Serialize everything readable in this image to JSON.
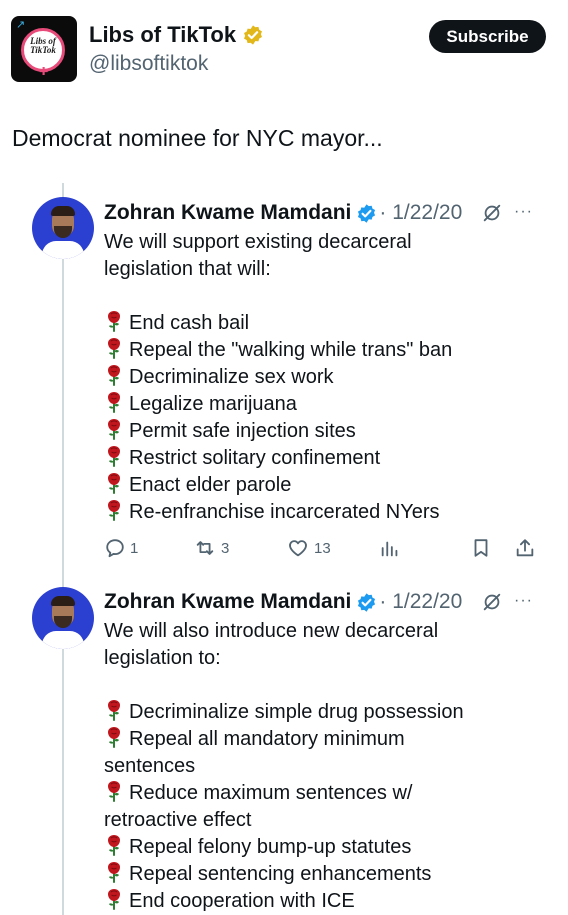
{
  "account": {
    "avatar_text_line1": "Libs of",
    "avatar_text_line2": "TikTok",
    "name": "Libs of TikTok",
    "handle": "@libsoftiktok",
    "verified_badge_icon": "gold-verified-badge-icon",
    "subscribe_label": "Subscribe"
  },
  "post": {
    "text": "Democrat nominee for NYC mayor..."
  },
  "colors": {
    "text": "#0f1419",
    "secondary": "#536471",
    "verified_blue": "#1d9bf0",
    "verified_gold": "#e2b719",
    "rose": "#c0161d",
    "subscribe_bg": "#0f1419"
  },
  "quoted_posts": [
    {
      "author": "Zohran Kwame Mamdani",
      "verified_icon": "blue-verified-badge-icon",
      "date": "· 1/22/20",
      "grok_icon": "grok-icon",
      "more_icon": "more-icon",
      "more_label": "···",
      "intro": [
        "We will support existing decarceral",
        "legislation that will:"
      ],
      "bullet_icon": "rose-emoji-icon",
      "items": [
        "End cash bail",
        "Repeal the \"walking while trans\" ban",
        "Decriminalize sex work",
        "Legalize marijuana",
        "Permit safe injection sites",
        "Restrict solitary confinement",
        "Enact elder parole",
        "Re-enfranchise incarcerated NYers"
      ],
      "actions": {
        "replies": "1",
        "reposts": "3",
        "likes": "13"
      }
    },
    {
      "author": "Zohran Kwame Mamdani",
      "verified_icon": "blue-verified-badge-icon",
      "date": "· 1/22/20",
      "grok_icon": "grok-icon",
      "more_icon": "more-icon",
      "more_label": "···",
      "intro": [
        "We will also introduce new decarceral",
        "legislation to:"
      ],
      "bullet_icon": "rose-emoji-icon",
      "items": [
        "Decriminalize simple drug possession",
        "Repeal all mandatory minimum sentences",
        "Reduce maximum sentences w/ retroactive effect",
        "Repeal felony bump-up statutes",
        "Repeal sentencing enhancements",
        "End cooperation with ICE"
      ]
    }
  ]
}
